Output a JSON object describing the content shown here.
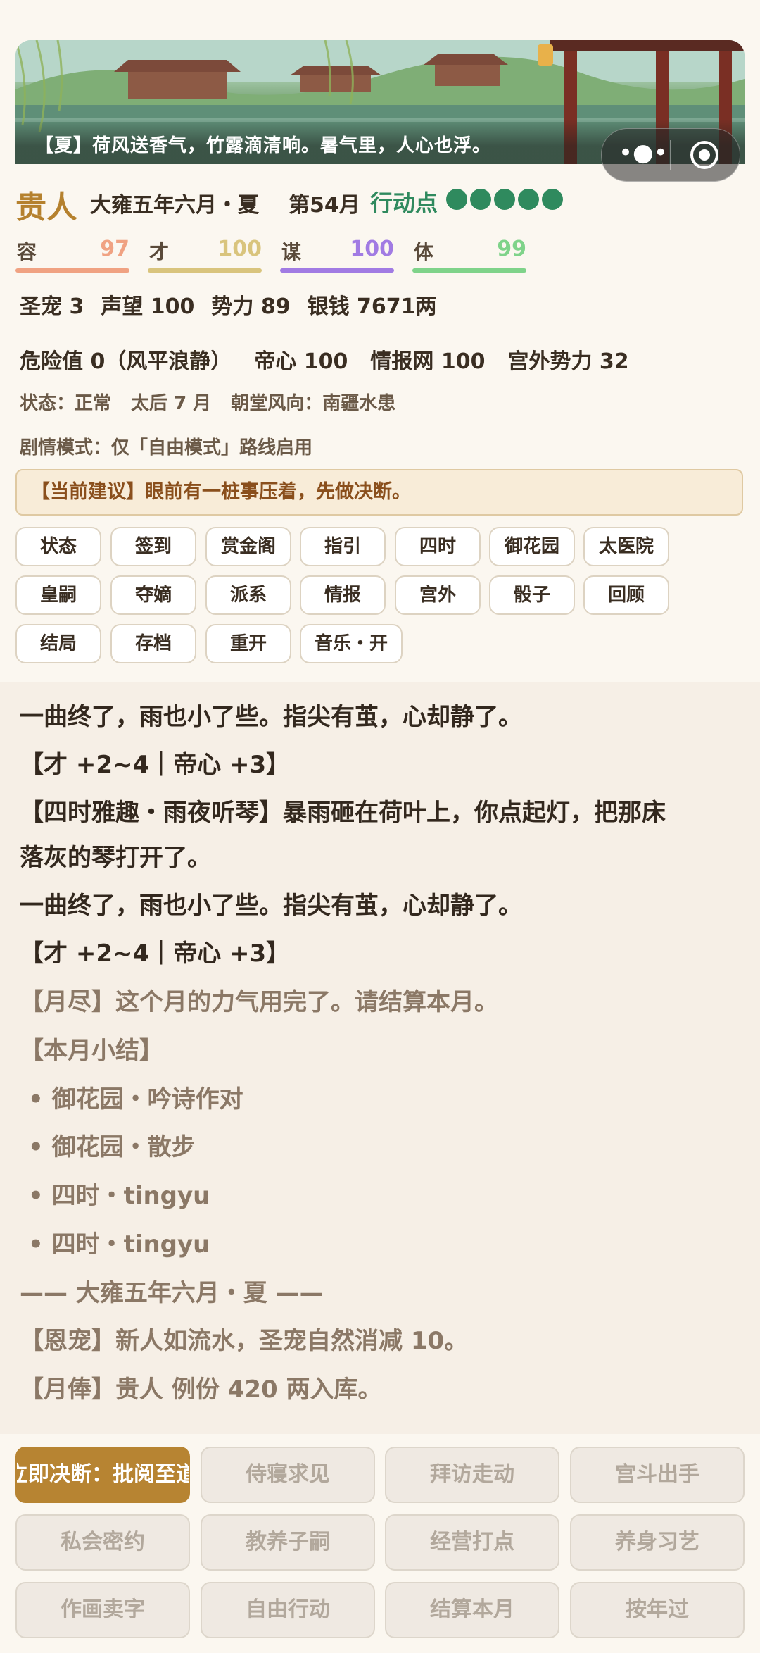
{
  "banner": {
    "caption": "【夏】荷风送香气，竹露滴清响。暑气里，人心也浮。"
  },
  "header": {
    "rank": "贵人",
    "date": "大雍五年六月・夏",
    "turn": "第54月",
    "action_points_label": "行动点",
    "action_points_total": 5,
    "action_points_remaining": 5,
    "action_point_color": "#2f8a5e"
  },
  "stats": [
    {
      "name": "容",
      "value": "97",
      "color": "#f0a282"
    },
    {
      "name": "才",
      "value": "100",
      "color": "#d9c47d"
    },
    {
      "name": "谋",
      "value": "100",
      "color": "#a17be3"
    },
    {
      "name": "体",
      "value": "99",
      "color": "#7fd38a"
    }
  ],
  "resources": [
    "圣宠 3",
    "声望 100",
    "势力 89",
    "银钱 7671两"
  ],
  "secondary": [
    "危险值 0（风平浪静）",
    "帝心 100",
    "情报网 100",
    "宫外势力 32"
  ],
  "status_line": [
    "状态：正常",
    "太后 7 月",
    "朝堂风向：南疆水患"
  ],
  "mode_line": "剧情模式：仅「自由模式」路线启用",
  "advice": "【当前建议】眼前有一桩事压着，先做决断。",
  "menu": {
    "row1": [
      "状态",
      "签到",
      "赏金阁",
      "指引",
      "四时",
      "御花园",
      "太医院"
    ],
    "row2": [
      "皇嗣",
      "夺嫡",
      "派系",
      "情报",
      "宫外",
      "骰子",
      "回顾"
    ],
    "row3": [
      "结局",
      "存档",
      "重开",
      "音乐・开"
    ]
  },
  "story": {
    "p1": "一曲终了，雨也小了些。指尖有茧，心却静了。",
    "p2": "【才 +2~4｜帝心 +3】",
    "p3a": "【四时雅趣・雨夜听琴】暴雨砸在荷叶上，你点起灯，把那床",
    "p3b": "落灰的琴打开了。",
    "p4": "一曲终了，雨也小了些。指尖有茧，心却静了。",
    "p5": "【才 +2~4｜帝心 +3】",
    "p6": "【月尽】这个月的力气用完了。请结算本月。",
    "p7": "【本月小结】",
    "summary": [
      "•  御花园・吟诗作对",
      "•  御花园・散步",
      "•  四时・tingyu",
      "•  四时・tingyu"
    ],
    "divider": "—— 大雍五年六月・夏 ——",
    "p8": "【恩宠】新人如流水，圣宠自然消减 10。",
    "p9": "【月俸】贵人 例份 420 两入库。"
  },
  "actions": {
    "primary": "立即决断：批阅至道",
    "row1": [
      "侍寝求见",
      "拜访走动",
      "宫斗出手"
    ],
    "row2": [
      "私会密约",
      "教养子嗣",
      "经营打点",
      "养身习艺"
    ],
    "row3": [
      "作画卖字",
      "自由行动",
      "结算本月",
      "按年过"
    ]
  }
}
